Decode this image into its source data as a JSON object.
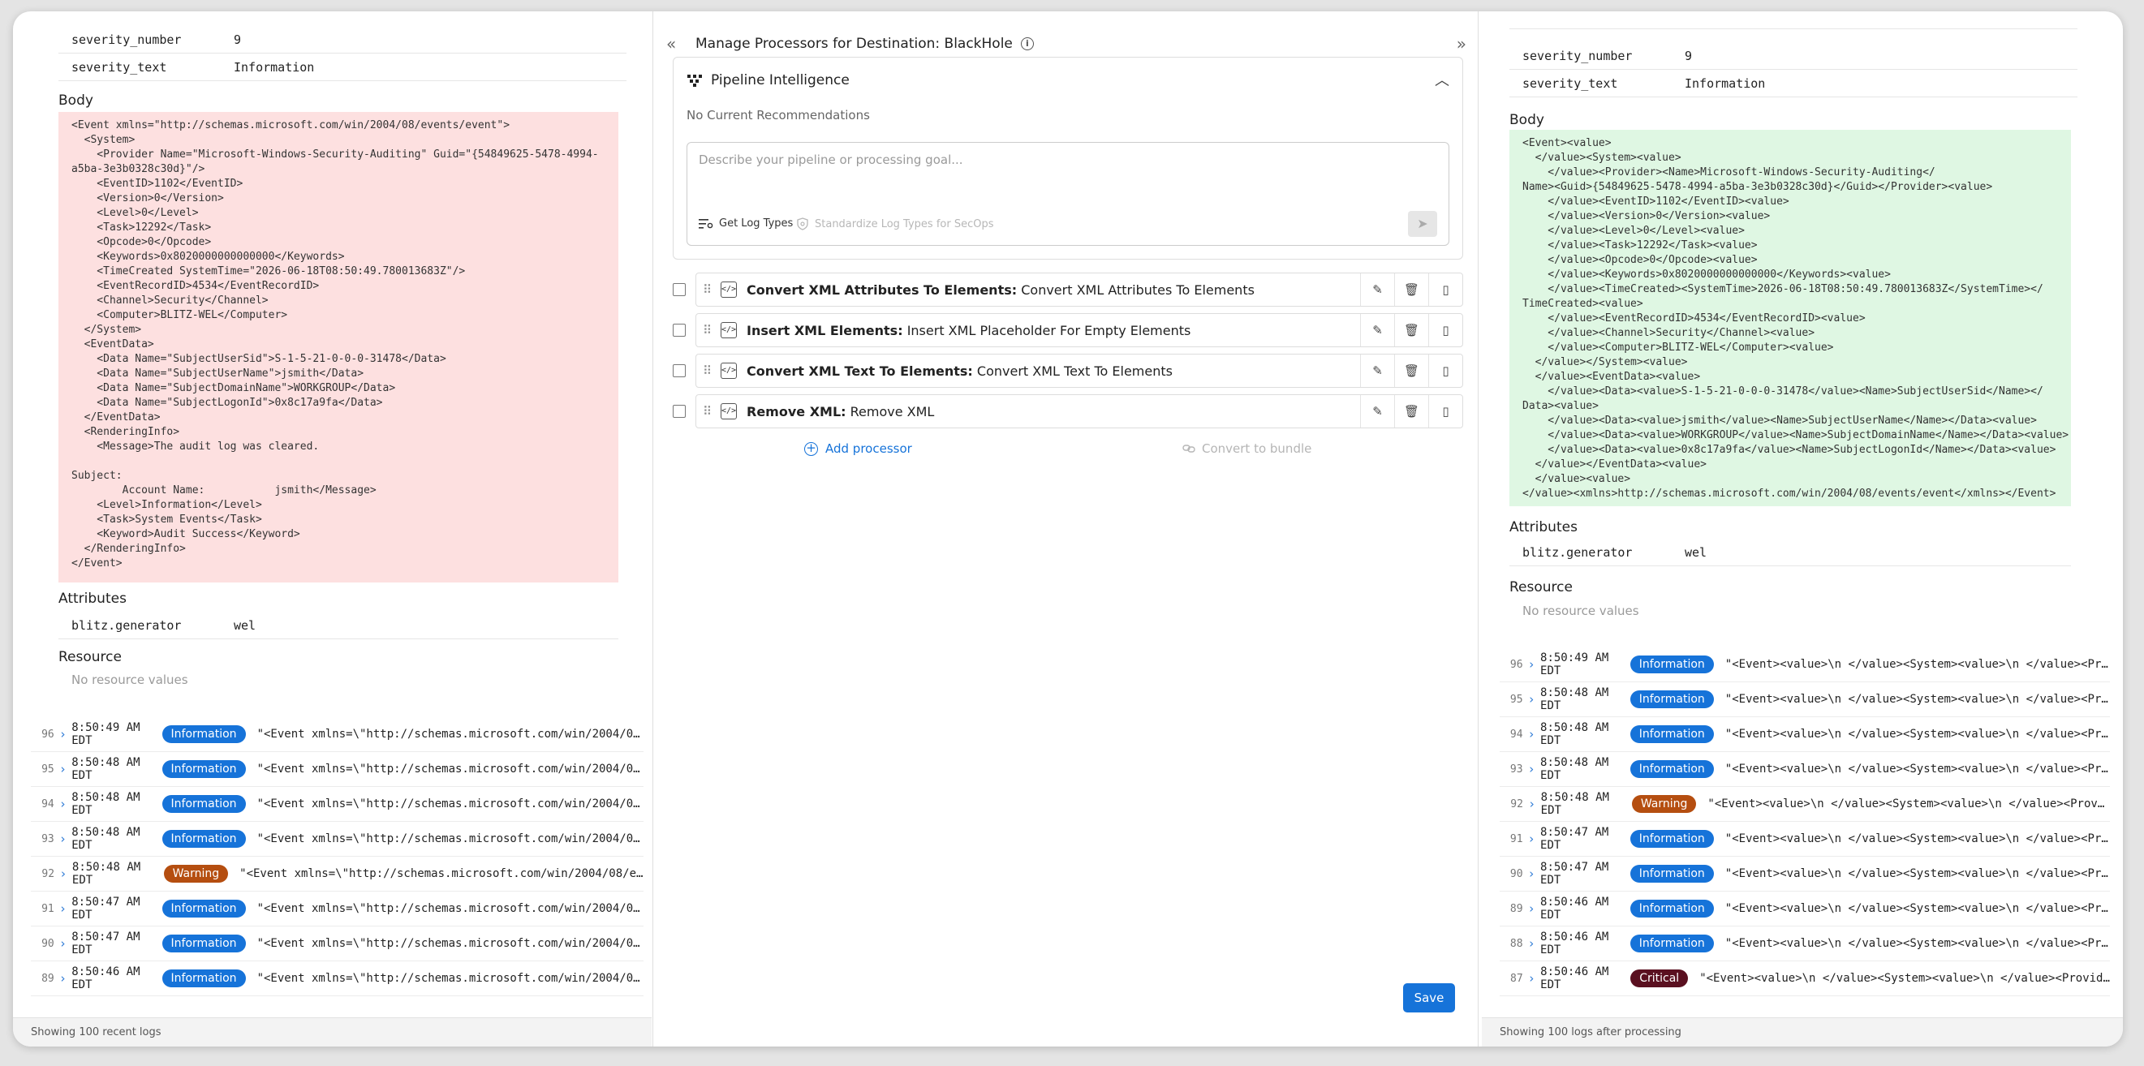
{
  "left": {
    "top_rows": [
      {
        "key": "severity_number",
        "value": "9"
      },
      {
        "key": "severity_text",
        "value": "Information"
      }
    ],
    "body_title": "Body",
    "body_xml": "<Event xmlns=\"http://schemas.microsoft.com/win/2004/08/events/event\">\n  <System>\n    <Provider Name=\"Microsoft-Windows-Security-Auditing\" Guid=\"{54849625-5478-4994-\na5ba-3e3b0328c30d}\"/>\n    <EventID>1102</EventID>\n    <Version>0</Version>\n    <Level>0</Level>\n    <Task>12292</Task>\n    <Opcode>0</Opcode>\n    <Keywords>0x8020000000000000</Keywords>\n    <TimeCreated SystemTime=\"2026-06-18T08:50:49.780013683Z\"/>\n    <EventRecordID>4534</EventRecordID>\n    <Channel>Security</Channel>\n    <Computer>BLITZ-WEL</Computer>\n  </System>\n  <EventData>\n    <Data Name=\"SubjectUserSid\">S-1-5-21-0-0-0-31478</Data>\n    <Data Name=\"SubjectUserName\">jsmith</Data>\n    <Data Name=\"SubjectDomainName\">WORKGROUP</Data>\n    <Data Name=\"SubjectLogonId\">0x8c17a9fa</Data>\n  </EventData>\n  <RenderingInfo>\n    <Message>The audit log was cleared.\n\nSubject:\n        Account Name:           jsmith</Message>\n    <Level>Information</Level>\n    <Task>System Events</Task>\n    <Keyword>Audit Success</Keyword>\n  </RenderingInfo>\n</Event>",
    "attributes_title": "Attributes",
    "attributes": [
      {
        "key": "blitz.generator",
        "value": "wel"
      }
    ],
    "resource_title": "Resource",
    "resource_empty": "No resource values",
    "logs": [
      {
        "num": "96",
        "time": "8:50:49 AM EDT",
        "level": "Information",
        "kind": "info",
        "msg": "\"<Event xmlns=\\\"http://schemas.microsoft.com/win/2004/08/event…"
      },
      {
        "num": "95",
        "time": "8:50:48 AM EDT",
        "level": "Information",
        "kind": "info",
        "msg": "\"<Event xmlns=\\\"http://schemas.microsoft.com/win/2004/08/event…"
      },
      {
        "num": "94",
        "time": "8:50:48 AM EDT",
        "level": "Information",
        "kind": "info",
        "msg": "\"<Event xmlns=\\\"http://schemas.microsoft.com/win/2004/08/event…"
      },
      {
        "num": "93",
        "time": "8:50:48 AM EDT",
        "level": "Information",
        "kind": "info",
        "msg": "\"<Event xmlns=\\\"http://schemas.microsoft.com/win/2004/08/event…"
      },
      {
        "num": "92",
        "time": "8:50:48 AM EDT",
        "level": "Warning",
        "kind": "warn",
        "msg": "\"<Event xmlns=\\\"http://schemas.microsoft.com/win/2004/08/events/…"
      },
      {
        "num": "91",
        "time": "8:50:47 AM EDT",
        "level": "Information",
        "kind": "info",
        "msg": "\"<Event xmlns=\\\"http://schemas.microsoft.com/win/2004/08/event…"
      },
      {
        "num": "90",
        "time": "8:50:47 AM EDT",
        "level": "Information",
        "kind": "info",
        "msg": "\"<Event xmlns=\\\"http://schemas.microsoft.com/win/2004/08/event…"
      },
      {
        "num": "89",
        "time": "8:50:46 AM EDT",
        "level": "Information",
        "kind": "info",
        "msg": "\"<Event xmlns=\\\"http://schemas.microsoft.com/win/2004/08/event…"
      }
    ],
    "footer": "Showing 100 recent logs"
  },
  "center": {
    "title": "Manage Processors for Destination: BlackHole",
    "left_toggle": "«",
    "right_toggle": "»",
    "pi": {
      "title": "Pipeline Intelligence",
      "subtitle": "No Current Recommendations",
      "placeholder": "Describe your pipeline or processing goal...",
      "tool_get_log_types": "Get Log Types",
      "tool_standardize": "Standardize Log Types for SecOps"
    },
    "processors": [
      {
        "name": "Convert XML Attributes To Elements:",
        "desc": " Convert XML Attributes To Elements"
      },
      {
        "name": "Insert XML Elements:",
        "desc": " Insert XML Placeholder For Empty Elements"
      },
      {
        "name": "Convert XML Text To Elements:",
        "desc": " Convert XML Text To Elements"
      },
      {
        "name": "Remove XML:",
        "desc": " Remove XML"
      }
    ],
    "add_processor": "Add processor",
    "convert_bundle": "Convert to bundle",
    "save": "Save"
  },
  "right": {
    "top_rows": [
      {
        "key": "severity_number",
        "value": "9"
      },
      {
        "key": "severity_text",
        "value": "Information"
      }
    ],
    "body_title": "Body",
    "body_xml": "<Event><value>\n  </value><System><value>\n    </value><Provider><Name>Microsoft-Windows-Security-Auditing</\nName><Guid>{54849625-5478-4994-a5ba-3e3b0328c30d}</Guid></Provider><value>\n    </value><EventID>1102</EventID><value>\n    </value><Version>0</Version><value>\n    </value><Level>0</Level><value>\n    </value><Task>12292</Task><value>\n    </value><Opcode>0</Opcode><value>\n    </value><Keywords>0x8020000000000000</Keywords><value>\n    </value><TimeCreated><SystemTime>2026-06-18T08:50:49.780013683Z</SystemTime></\nTimeCreated><value>\n    </value><EventRecordID>4534</EventRecordID><value>\n    </value><Channel>Security</Channel><value>\n    </value><Computer>BLITZ-WEL</Computer><value>\n  </value></System><value>\n  </value><EventData><value>\n    </value><Data><value>S-1-5-21-0-0-0-31478</value><Name>SubjectUserSid</Name></\nData><value>\n    </value><Data><value>jsmith</value><Name>SubjectUserName</Name></Data><value>\n    </value><Data><value>WORKGROUP</value><Name>SubjectDomainName</Name></Data><value>\n    </value><Data><value>0x8c17a9fa</value><Name>SubjectLogonId</Name></Data><value>\n  </value></EventData><value>\n  </value><value>\n</value><xmlns>http://schemas.microsoft.com/win/2004/08/events/event</xmlns></Event>",
    "attributes_title": "Attributes",
    "attributes": [
      {
        "key": "blitz.generator",
        "value": "wel"
      }
    ],
    "resource_title": "Resource",
    "resource_empty": "No resource values",
    "logs": [
      {
        "num": "96",
        "time": "8:50:49 AM EDT",
        "level": "Information",
        "kind": "info",
        "msg": "\"<Event><value>\\n </value><System><value>\\n </value><Provider>…"
      },
      {
        "num": "95",
        "time": "8:50:48 AM EDT",
        "level": "Information",
        "kind": "info",
        "msg": "\"<Event><value>\\n </value><System><value>\\n </value><Provider>…"
      },
      {
        "num": "94",
        "time": "8:50:48 AM EDT",
        "level": "Information",
        "kind": "info",
        "msg": "\"<Event><value>\\n </value><System><value>\\n </value><Provider>…"
      },
      {
        "num": "93",
        "time": "8:50:48 AM EDT",
        "level": "Information",
        "kind": "info",
        "msg": "\"<Event><value>\\n </value><System><value>\\n </value><Provider>…"
      },
      {
        "num": "92",
        "time": "8:50:48 AM EDT",
        "level": "Warning",
        "kind": "warn",
        "msg": "\"<Event><value>\\n </value><System><value>\\n </value><Provider><N…"
      },
      {
        "num": "91",
        "time": "8:50:47 AM EDT",
        "level": "Information",
        "kind": "info",
        "msg": "\"<Event><value>\\n </value><System><value>\\n </value><Provider>…"
      },
      {
        "num": "90",
        "time": "8:50:47 AM EDT",
        "level": "Information",
        "kind": "info",
        "msg": "\"<Event><value>\\n </value><System><value>\\n </value><Provider>…"
      },
      {
        "num": "89",
        "time": "8:50:46 AM EDT",
        "level": "Information",
        "kind": "info",
        "msg": "\"<Event><value>\\n </value><System><value>\\n </value><Provider>…"
      },
      {
        "num": "88",
        "time": "8:50:46 AM EDT",
        "level": "Information",
        "kind": "info",
        "msg": "\"<Event><value>\\n </value><System><value>\\n </value><Provider>…"
      },
      {
        "num": "87",
        "time": "8:50:46 AM EDT",
        "level": "Critical",
        "kind": "crit",
        "msg": "\"<Event><value>\\n </value><System><value>\\n </value><Provider><Nam…"
      }
    ],
    "footer": "Showing 100 logs after processing"
  }
}
